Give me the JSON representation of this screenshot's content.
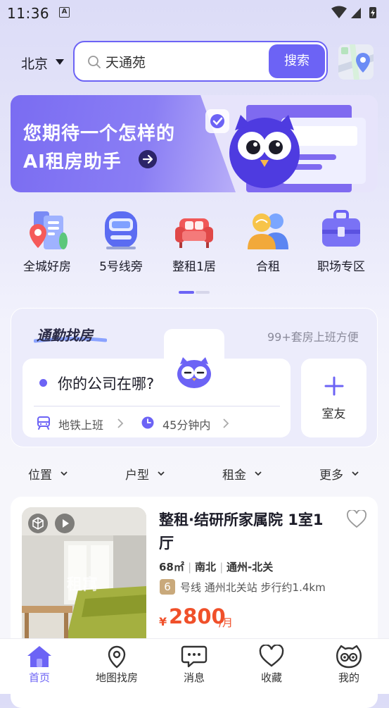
{
  "status_bar": {
    "time": "11:36",
    "notif_icon": "a-icon"
  },
  "header": {
    "city": "北京",
    "search_value": "天通苑",
    "search_button": "搜索"
  },
  "banner": {
    "line1": "您期待一个怎样的",
    "line2": "AI租房助手"
  },
  "categories": [
    {
      "label": "全城好房",
      "icon": "city-houses-icon"
    },
    {
      "label": "5号线旁",
      "icon": "subway-train-icon"
    },
    {
      "label": "整租1居",
      "icon": "sofa-icon"
    },
    {
      "label": "合租",
      "icon": "people-icon"
    },
    {
      "label": "职场专区",
      "icon": "briefcase-icon"
    }
  ],
  "commute": {
    "title": "通勤找房",
    "subtitle": "99+套房上班方便",
    "company_prompt": "你的公司在哪?",
    "transport": "地铁上班",
    "duration": "45分钟内",
    "roommate": "室友"
  },
  "filters": [
    "位置",
    "户型",
    "租金",
    "更多"
  ],
  "listing": {
    "title": "整租·结研所家属院 1室1厅",
    "area": "68㎡",
    "orientation": "南北",
    "district": "通州-北关",
    "line_number": "6",
    "station": "号线  通州北关站  步行约1.4km",
    "price_symbol": "¥",
    "price": "2800",
    "price_unit": "/月",
    "watermark": "租寓"
  },
  "bottom_nav": [
    {
      "label": "首页",
      "icon": "home-icon",
      "active": true
    },
    {
      "label": "地图找房",
      "icon": "map-pin-icon",
      "active": false
    },
    {
      "label": "消息",
      "icon": "message-icon",
      "active": false
    },
    {
      "label": "收藏",
      "icon": "heart-icon",
      "active": false
    },
    {
      "label": "我的",
      "icon": "owl-profile-icon",
      "active": false
    }
  ],
  "colors": {
    "accent": "#6c63f5",
    "price": "#f0502a",
    "line6": "#c9a97b"
  }
}
